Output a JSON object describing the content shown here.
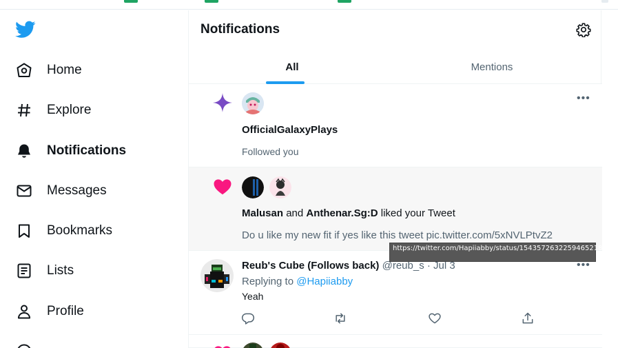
{
  "sidebar": {
    "logo": "twitter-bird-icon",
    "items": [
      {
        "label": "Home",
        "icon": "home-icon"
      },
      {
        "label": "Explore",
        "icon": "hashtag-icon"
      },
      {
        "label": "Notifications",
        "icon": "bell-icon",
        "active": true
      },
      {
        "label": "Messages",
        "icon": "envelope-icon"
      },
      {
        "label": "Bookmarks",
        "icon": "bookmark-icon"
      },
      {
        "label": "Lists",
        "icon": "list-icon"
      },
      {
        "label": "Profile",
        "icon": "person-icon"
      }
    ]
  },
  "header": {
    "title": "Notifications",
    "settings_icon": "gear-icon"
  },
  "tabs": [
    {
      "label": "All",
      "selected": true
    },
    {
      "label": "Mentions",
      "selected": false
    }
  ],
  "notifications": [
    {
      "kind_icon": "sparkle-icon",
      "user": "OfficialGalaxyPlays",
      "text": "Followed you"
    },
    {
      "kind_icon": "heart-icon",
      "user1": "Malusan",
      "connector": "and",
      "user2": "Anthenar.Sg:D",
      "action": "liked your Tweet",
      "tweet_text": "Do u like my new fit if yes like this tweet pic.twitter.com/5xNVLPtvZ2"
    },
    {
      "display_name": "Reub's Cube (Follows back)",
      "handle": "@reub_s",
      "separator": "·",
      "date": "Jul 3",
      "replying_prefix": "Replying to",
      "replying_to": "@Hapiiabby",
      "text": "Yeah",
      "actions": [
        "reply-icon",
        "retweet-icon",
        "like-icon",
        "share-icon"
      ]
    }
  ],
  "tooltip": "https://twitter.com/Hapiiabby/status/1543572632259465218/photo/1",
  "colors": {
    "accent": "#1d9bf0",
    "sparkle": "#794bc4",
    "heart": "#f91880",
    "text": "#0f1419",
    "secondary": "#536471"
  }
}
